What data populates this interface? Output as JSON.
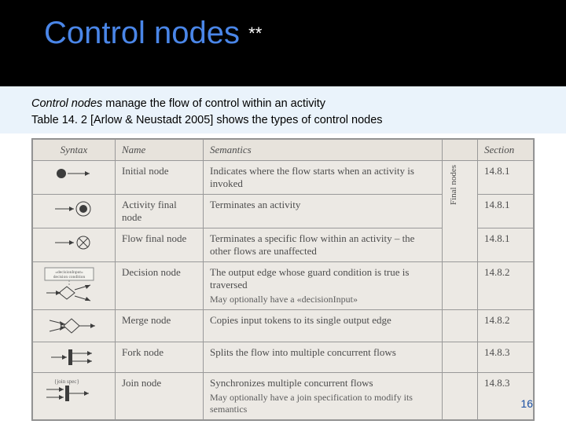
{
  "title": "Control nodes",
  "title_suffix": "**",
  "intro": {
    "lead_term": "Control nodes",
    "line1_rest": " manage the flow of control within an activity",
    "line2": "Table 14. 2 [Arlow & Neustadt 2005] shows the types of control nodes"
  },
  "table": {
    "headers": {
      "syntax": "Syntax",
      "name": "Name",
      "semantics": "Semantics",
      "section": "Section"
    },
    "final_nodes_label": "Final nodes",
    "rows": [
      {
        "name": "Initial node",
        "semantics": "Indicates where the flow starts when an activity is invoked",
        "section": "14.8.1"
      },
      {
        "name": "Activity final node",
        "semantics": "Terminates an activity",
        "section": "14.8.1"
      },
      {
        "name": "Flow final node",
        "semantics": "Terminates a specific flow within an activity – the other flows are unaffected",
        "section": "14.8.1"
      },
      {
        "name": "Decision node",
        "semantics": "The output edge whose guard condition is true is traversed",
        "semantics2": "May optionally have a «decisionInput»",
        "section": "14.8.2"
      },
      {
        "name": "Merge node",
        "semantics": "Copies input tokens to its single output edge",
        "section": "14.8.2"
      },
      {
        "name": "Fork node",
        "semantics": "Splits the flow into multiple concurrent flows",
        "section": "14.8.3"
      },
      {
        "name": "Join node",
        "semantics": "Synchronizes multiple concurrent flows",
        "semantics2": "May optionally have a join specification to modify its semantics",
        "section": "14.8.3"
      }
    ],
    "decision_tag": "«decisionInput»\ndecision condition",
    "join_tag": "{join spec}"
  },
  "page_number": "16"
}
